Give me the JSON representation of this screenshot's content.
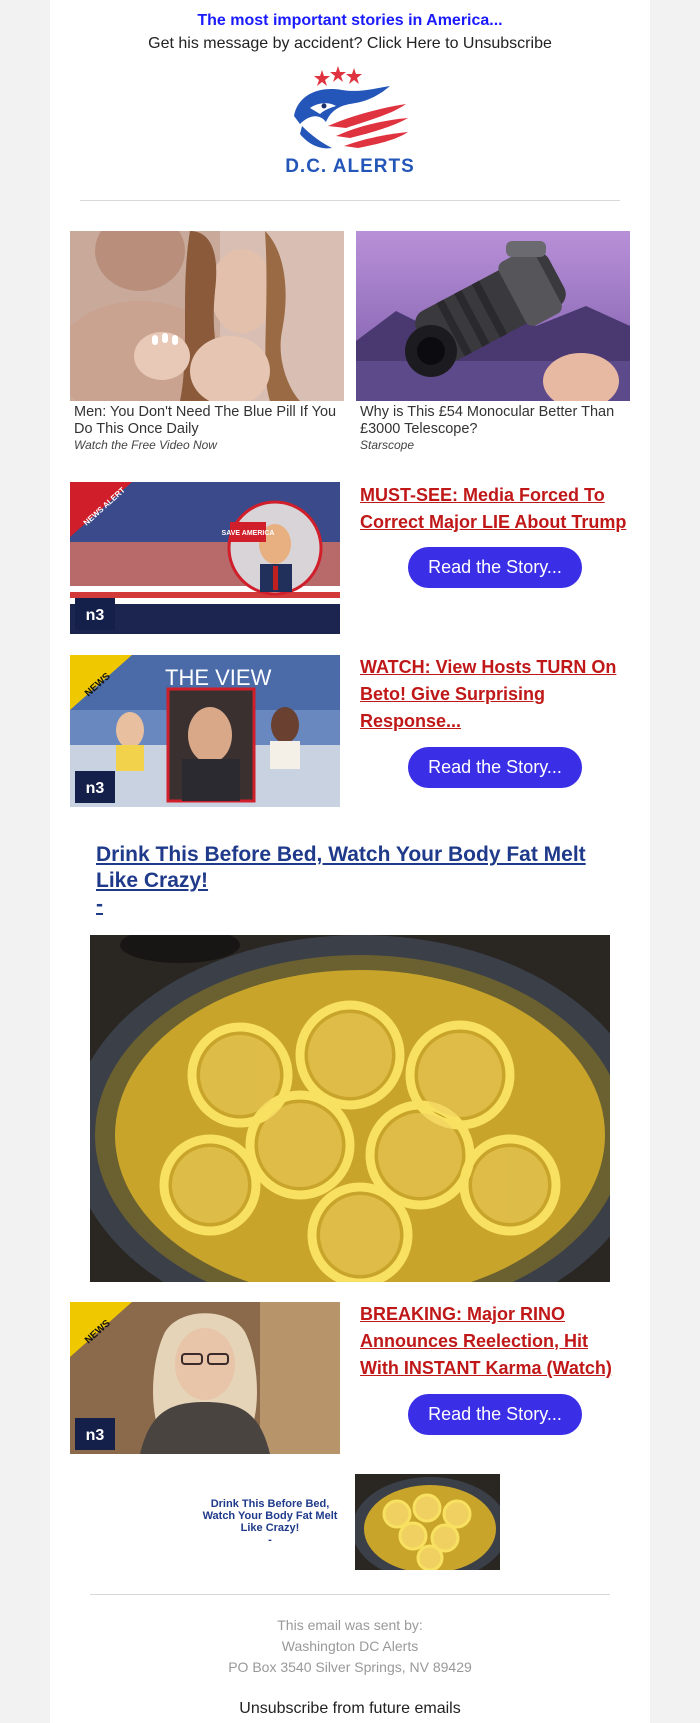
{
  "header": {
    "tagline": "The most important stories in America...",
    "unsubscribe_line": "Get his message by accident? Click Here to Unsubscribe",
    "logo_text": "D.C. ALERTS"
  },
  "ads_top": [
    {
      "title": "Men: You Don't Need The Blue Pill If You Do This Once Daily",
      "source": "Watch the Free Video Now"
    },
    {
      "title": "Why is This £54 Monocular Better Than £3000 Telescope?",
      "source": "Starscope"
    }
  ],
  "stories": [
    {
      "title": "MUST-SEE: Media Forced To Correct Major LIE About Trump",
      "button": "Read the Story...",
      "badge": "NEWS ALERT",
      "sign": "SAVE AMERICA"
    },
    {
      "title": "WATCH: View Hosts TURN On Beto! Give Surprising Response...",
      "button": "Read the Story...",
      "badge": "NEWS",
      "show": "THE VIEW"
    },
    {
      "title": "BREAKING: Major RINO Announces Reelection, Hit With INSTANT Karma (Watch)",
      "button": "Read the Story...",
      "badge": "NEWS"
    }
  ],
  "brand_mark": "n3",
  "featured_ad": {
    "title": "Drink This Before Bed, Watch Your Body Fat Melt Like Crazy!",
    "dash": "-"
  },
  "small_ad": {
    "title": "Drink This Before Bed, Watch Your Body Fat Melt Like Crazy!",
    "dash": "-"
  },
  "footer": {
    "sent_by": "This email was sent by:",
    "company": "Washington DC Alerts",
    "address": "PO Box 3540 Silver Springs, NV 89429",
    "unsubscribe": "Unsubscribe from future emails"
  },
  "colors": {
    "tagline": "#1a1aff",
    "story_title": "#c01818",
    "button": "#3a2ee6",
    "featured_title": "#1f3a8a",
    "logo_blue": "#2356b8",
    "logo_red": "#e03340"
  }
}
